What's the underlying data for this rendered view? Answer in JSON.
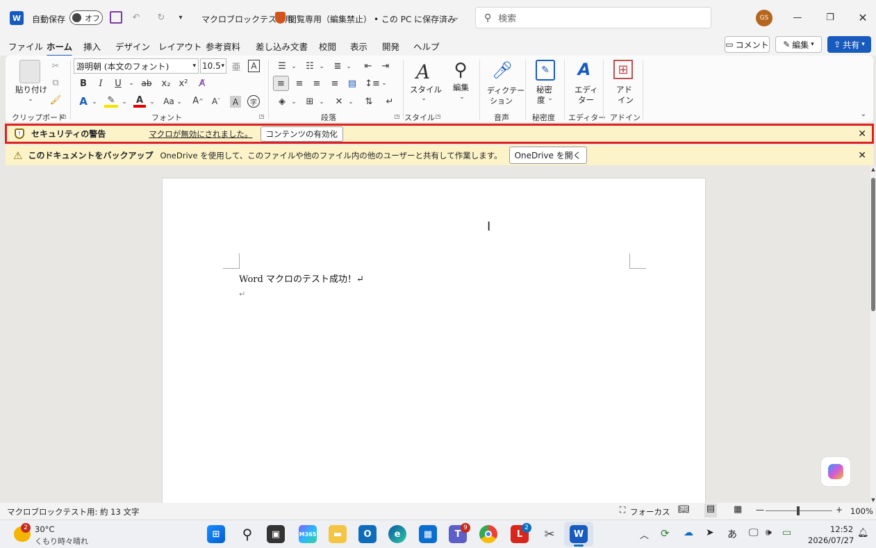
{
  "titlebar": {
    "autosave_label": "自動保存",
    "autosave_state": "オフ",
    "doc_title": "マクロブロックテスト用",
    "readonly_label": "閲覧専用（編集禁止）",
    "save_location": "• この PC に保存済み",
    "search_placeholder": "検索",
    "avatar_initials": "GS"
  },
  "tabs": [
    "ファイル",
    "ホーム",
    "挿入",
    "デザイン",
    "レイアウト",
    "参考資料",
    "差し込み文書",
    "校閲",
    "表示",
    "開発",
    "ヘルプ"
  ],
  "right_buttons": {
    "comment": "コメント",
    "edit": "編集",
    "share": "共有"
  },
  "ribbon": {
    "paste_label": "貼り付け",
    "font_name": "游明朝 (本文のフォント)",
    "font_size": "10.5",
    "style_label": "スタイル",
    "edit_label": "編集",
    "dictate_label": "ディクテー",
    "dictate_label2": "ション",
    "sensitivity_label": "秘密",
    "sensitivity_label2": "度",
    "editor_label": "エディ",
    "editor_label2": "ター",
    "addin_label": "アド",
    "addin_label2": "イン",
    "groups": {
      "clipboard": "クリップボード",
      "font": "フォント",
      "paragraph": "段落",
      "style": "スタイル",
      "voice": "音声",
      "sensitivity": "秘密度",
      "editor": "エディター",
      "addin": "アドイン"
    }
  },
  "security_bar": {
    "title": "セキュリティの警告",
    "message": "マクロが無効にされました。",
    "button": "コンテンツの有効化",
    "highlight_color": "#e02020"
  },
  "backup_bar": {
    "title": "このドキュメントをバックアップ",
    "message": "OneDrive を使用して、このファイルや他のファイル内の他のユーザーと共有して作業します。",
    "button": "OneDrive を開く"
  },
  "document": {
    "line1": "Word マクロのテスト成功！↵",
    "line2": "↵"
  },
  "statusbar": {
    "word_count": "マクロブロックテスト用: 約 13 文字",
    "focus": "フォーカス",
    "zoom": "100%"
  },
  "taskbar": {
    "weather_temp": "30°C",
    "weather_desc": "くもり時々晴れ",
    "weather_badge": "2",
    "teams_badge": "9",
    "l_badge": "2",
    "time": "12:52",
    "date": "2026/07/27",
    "ime": "あ"
  },
  "colors": {
    "accent": "#185abd",
    "warning_bg": "#fdf3c9"
  }
}
